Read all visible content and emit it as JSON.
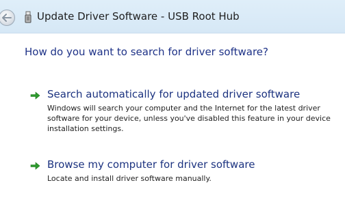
{
  "window": {
    "title": "Update Driver Software - USB Root Hub"
  },
  "main": {
    "heading": "How do you want to search for driver software?",
    "options": [
      {
        "title": "Search automatically for updated driver software",
        "description": "Windows will search your computer and the Internet for the latest driver software for your device, unless you've disabled this feature in your device installation settings."
      },
      {
        "title": "Browse my computer for driver software",
        "description": "Locate and install driver software manually."
      }
    ]
  },
  "icons": {
    "back": "back-arrow-icon",
    "device": "usb-device-icon",
    "option_arrow": "green-arrow-icon"
  },
  "colors": {
    "titlebar": "#d6e8f6",
    "heading": "#1e3287",
    "option_title": "#1c3380",
    "arrow": "#2e9a2e"
  }
}
